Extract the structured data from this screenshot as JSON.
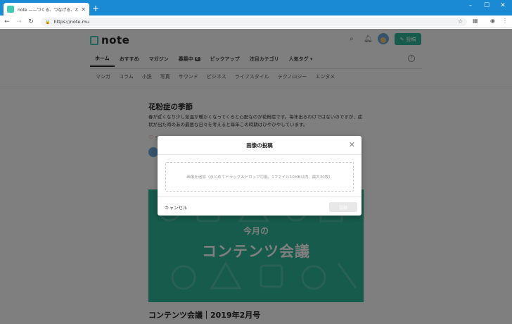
{
  "browser": {
    "tab_title": "note ——つくる、つなげる、とどける。",
    "url": "https://note.mu",
    "minimize": "–",
    "maximize": "☐",
    "close": "✕"
  },
  "header": {
    "logo": "note",
    "post_button": "投稿"
  },
  "nav": {
    "tabs": [
      {
        "label": "ホーム"
      },
      {
        "label": "おすすめ"
      },
      {
        "label": "マガジン"
      },
      {
        "label": "募集中",
        "badge": "6"
      },
      {
        "label": "ピックアップ"
      },
      {
        "label": "注目カテゴリ"
      },
      {
        "label": "人気タグ ▾"
      }
    ],
    "subnav": [
      "マンガ",
      "コラム",
      "小説",
      "写真",
      "サウンド",
      "ビジネス",
      "ライフスタイル",
      "テクノロジー",
      "エンタメ"
    ]
  },
  "article": {
    "title": "花粉症の季節",
    "body": "春が近くなり少し気温が暖かくなってくると心配なのが花粉症です。毎年出るわけではないのですが、症状が出た時のあの最悪な日々を考えると毎年この時期はひやひやしています。",
    "heart": "♡",
    "heart_count": "5"
  },
  "banner": {
    "subtitle": "今月の",
    "title": "コンテンツ会議"
  },
  "next_article": {
    "title": "コンテンツ会議｜2019年2月号"
  },
  "modal": {
    "title": "画像の投稿",
    "close": "✕",
    "dropzone_text": "画像を追加（まとめてドラッグ＆ドロップ可能。1ファイル10MB以内、最大30枚）",
    "cancel": "キャンセル",
    "submit": "投稿"
  },
  "colors": {
    "brand": "#2cb696",
    "titlebar": "#1a8ad4"
  }
}
